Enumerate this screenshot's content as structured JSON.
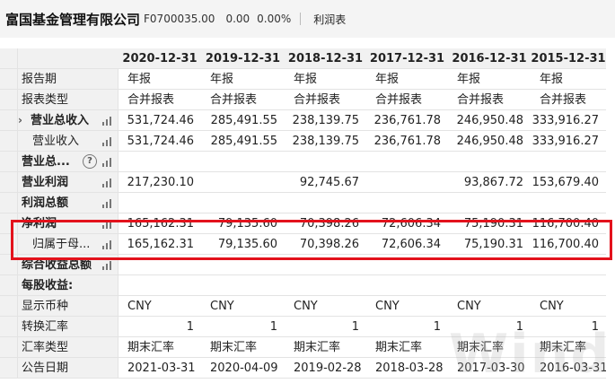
{
  "header": {
    "company": "富国基金管理有限公司",
    "code": "F0700035.00",
    "change": "0.00",
    "change_pct": "0.00%",
    "tab": "利润表"
  },
  "columns": [
    "2020-12-31",
    "2019-12-31",
    "2018-12-31",
    "2017-12-31",
    "2016-12-31",
    "2015-12-31"
  ],
  "rows": [
    {
      "label": "报告期",
      "values": [
        "年报",
        "年报",
        "年报",
        "年报",
        "年报",
        "年报"
      ]
    },
    {
      "label": "报表类型",
      "values": [
        "合并报表",
        "合并报表",
        "合并报表",
        "合并报表",
        "合并报表",
        "合并报表"
      ]
    },
    {
      "label": "营业总收入",
      "values": [
        "531,724.46",
        "285,491.55",
        "238,139.75",
        "236,761.78",
        "246,950.48",
        "333,916.27"
      ]
    },
    {
      "label": "营业收入",
      "values": [
        "531,724.46",
        "285,491.55",
        "238,139.75",
        "236,761.78",
        "246,950.48",
        "333,916.27"
      ]
    },
    {
      "label": "营业总...",
      "values": [
        "",
        "",
        "",
        "",
        "",
        ""
      ]
    },
    {
      "label": "营业利润",
      "values": [
        "217,230.10",
        "",
        "92,745.67",
        "",
        "93,867.72",
        "153,679.40"
      ]
    },
    {
      "label": "利润总额",
      "values": [
        "",
        "",
        "",
        "",
        "",
        ""
      ]
    },
    {
      "label": "净利润",
      "values": [
        "165,162.31",
        "79,135.60",
        "70,398.26",
        "72,606.34",
        "75,190.31",
        "116,700.40"
      ]
    },
    {
      "label": "归属于母...",
      "values": [
        "165,162.31",
        "79,135.60",
        "70,398.26",
        "72,606.34",
        "75,190.31",
        "116,700.40"
      ]
    },
    {
      "label": "综合收益总额",
      "values": [
        "",
        "",
        "",
        "",
        "",
        ""
      ]
    },
    {
      "label": "每股收益:",
      "values": [
        "",
        "",
        "",
        "",
        "",
        ""
      ]
    },
    {
      "label": "显示币种",
      "values": [
        "CNY",
        "CNY",
        "CNY",
        "CNY",
        "CNY",
        "CNY"
      ]
    },
    {
      "label": "转换汇率",
      "values": [
        "1",
        "1",
        "1",
        "1",
        "1",
        "1"
      ]
    },
    {
      "label": "汇率类型",
      "values": [
        "期末汇率",
        "期末汇率",
        "期末汇率",
        "期末汇率",
        "期末汇率",
        "期末汇率"
      ]
    },
    {
      "label": "公告日期",
      "values": [
        "2021-03-31",
        "2020-04-09",
        "2019-02-28",
        "2018-03-28",
        "2017-03-30",
        "2016-03-31"
      ]
    }
  ],
  "icons": {
    "chart": "bar-chart-icon",
    "help": "question-icon",
    "expand": "chevron-right-icon"
  },
  "colors": {
    "highlight": "#e3121c",
    "header_bg": "#f1f1f1"
  }
}
